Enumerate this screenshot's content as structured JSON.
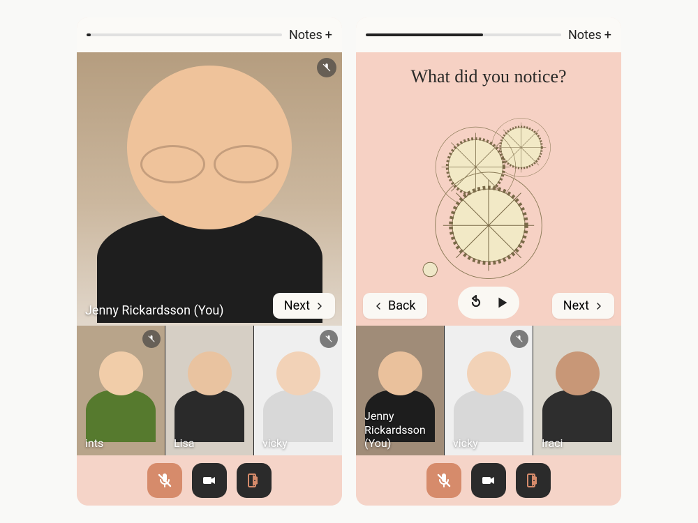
{
  "screens": [
    {
      "topbar": {
        "progress": 2,
        "notes_label": "Notes"
      },
      "main": {
        "caption": "Jenny Rickardsson (You)",
        "muted": true,
        "next_label": "Next"
      },
      "thumbs": [
        {
          "name": "ints",
          "muted": true,
          "bg": "#b8a48a",
          "skin": "#f1cda9",
          "shirt": "#567a2e"
        },
        {
          "name": "Lisa",
          "muted": false,
          "bg": "#d6cfc5",
          "skin": "#e9c3a0",
          "shirt": "#2a2a2a"
        },
        {
          "name": "vicky",
          "muted": true,
          "bg": "#efefef",
          "skin": "#f2d2b7",
          "shirt": "#d8d8d8"
        }
      ]
    },
    {
      "topbar": {
        "progress": 60,
        "notes_label": "Notes"
      },
      "content": {
        "question": "What did you notice?",
        "back_label": "Back",
        "next_label": "Next"
      },
      "thumbs": [
        {
          "name": "Jenny Rickardsson (You)",
          "muted": false,
          "bg": "#a08c78",
          "skin": "#eac19c",
          "shirt": "#1d1d1d"
        },
        {
          "name": "vicky",
          "muted": true,
          "bg": "#efefef",
          "skin": "#f2d2b7",
          "shirt": "#d8d8d8"
        },
        {
          "name": "Iraci",
          "muted": false,
          "bg": "#dad6cc",
          "skin": "#c89777",
          "shirt": "#2e2e2e"
        }
      ]
    }
  ],
  "controls": {
    "mic_icon": "mic-muted-icon",
    "camera_icon": "camera-icon",
    "exit_icon": "exit-icon"
  },
  "colors": {
    "pink": "#f5d4c8",
    "accent": "#d68b6b",
    "dark": "#2b2b2b"
  }
}
